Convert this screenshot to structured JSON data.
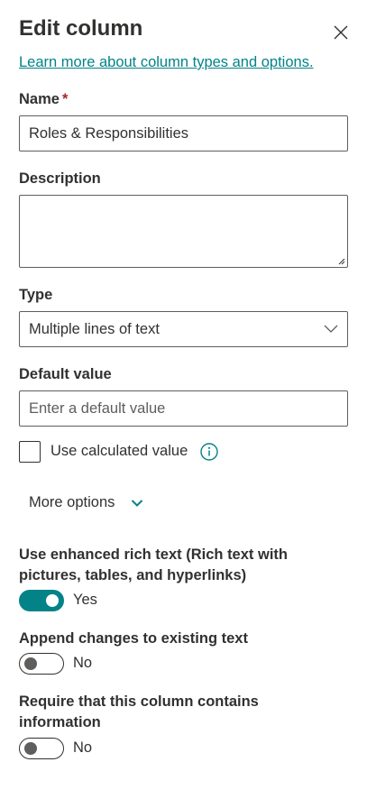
{
  "panel": {
    "title": "Edit column",
    "help_link": "Learn more about column types and options."
  },
  "fields": {
    "name": {
      "label": "Name",
      "required_mark": "*",
      "value": "Roles & Responsibilities"
    },
    "description": {
      "label": "Description",
      "value": ""
    },
    "type": {
      "label": "Type",
      "selected": "Multiple lines of text"
    },
    "default_value": {
      "label": "Default value",
      "placeholder": "Enter a default value"
    },
    "calculated": {
      "label": "Use calculated value",
      "checked": false
    }
  },
  "more_options": {
    "label": "More options"
  },
  "toggles": [
    {
      "question": "Use enhanced rich text (Rich text with pictures, tables, and hyperlinks)",
      "state_label": "Yes",
      "on": true
    },
    {
      "question": "Append changes to existing text",
      "state_label": "No",
      "on": false
    },
    {
      "question": "Require that this column contains information",
      "state_label": "No",
      "on": false
    }
  ],
  "colors": {
    "accent": "#038387",
    "required": "#a4262c",
    "text": "#323130",
    "border": "#605e5c"
  },
  "icons": {
    "close": "close-icon",
    "dropdown": "chevron-down-icon",
    "info": "info-icon",
    "more": "chevron-down-icon"
  }
}
